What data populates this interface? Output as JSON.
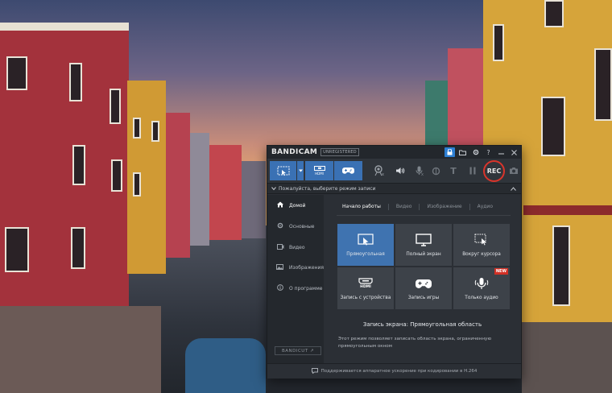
{
  "app": {
    "brand_primary": "BANDI",
    "brand_secondary": "CAM",
    "license_badge": "UNREGISTERED",
    "accent_color": "#3a71b4",
    "rec_color": "#d9342b"
  },
  "titlebar_icons": [
    "lock-icon",
    "folder-icon",
    "settings-icon",
    "help-icon",
    "minimize-icon",
    "close-icon"
  ],
  "toolbar": {
    "rec_label": "REC",
    "hdmi_label": "HDMI",
    "tools": [
      "webcam-icon",
      "speaker-icon",
      "microphone-icon",
      "draw-icon",
      "text-icon",
      "pause-icon",
      "camera-icon"
    ]
  },
  "prompt": {
    "text": "Пожалуйста, выберите режим записи"
  },
  "sidebar": {
    "items": [
      {
        "label": "Домой",
        "icon": "home-icon",
        "active": true
      },
      {
        "label": "Основные",
        "icon": "gear-icon",
        "active": false
      },
      {
        "label": "Видео",
        "icon": "video-icon",
        "active": false
      },
      {
        "label": "Изображения",
        "icon": "image-icon",
        "active": false
      },
      {
        "label": "О программе",
        "icon": "info-icon",
        "active": false
      }
    ],
    "brand_button": "BANDICUT ↗"
  },
  "tabs": [
    {
      "label": "Начало работы",
      "active": true
    },
    {
      "label": "Видео",
      "active": false
    },
    {
      "label": "Изображение",
      "active": false
    },
    {
      "label": "Аудио",
      "active": false
    }
  ],
  "modes": [
    {
      "label": "Прямоугольная",
      "icon": "rectangle-select-icon",
      "active": true
    },
    {
      "label": "Полный экран",
      "icon": "monitor-icon",
      "active": false
    },
    {
      "label": "Вокруг курсора",
      "icon": "cursor-area-icon",
      "active": false
    },
    {
      "label": "Запись с устройства",
      "icon": "hdmi-icon",
      "active": false
    },
    {
      "label": "Запись игры",
      "icon": "gamepad-icon",
      "active": false
    },
    {
      "label": "Только аудио",
      "icon": "microphone-icon",
      "active": false,
      "badge": "NEW"
    }
  ],
  "description": {
    "title": "Запись экрана: Прямоугольная область",
    "text": "Этот режим позволяет записать область экрана, ограниченную прямоугольным окном"
  },
  "footer": {
    "text": "Поддерживается аппаратное ускорение при кодировании в H.264"
  }
}
